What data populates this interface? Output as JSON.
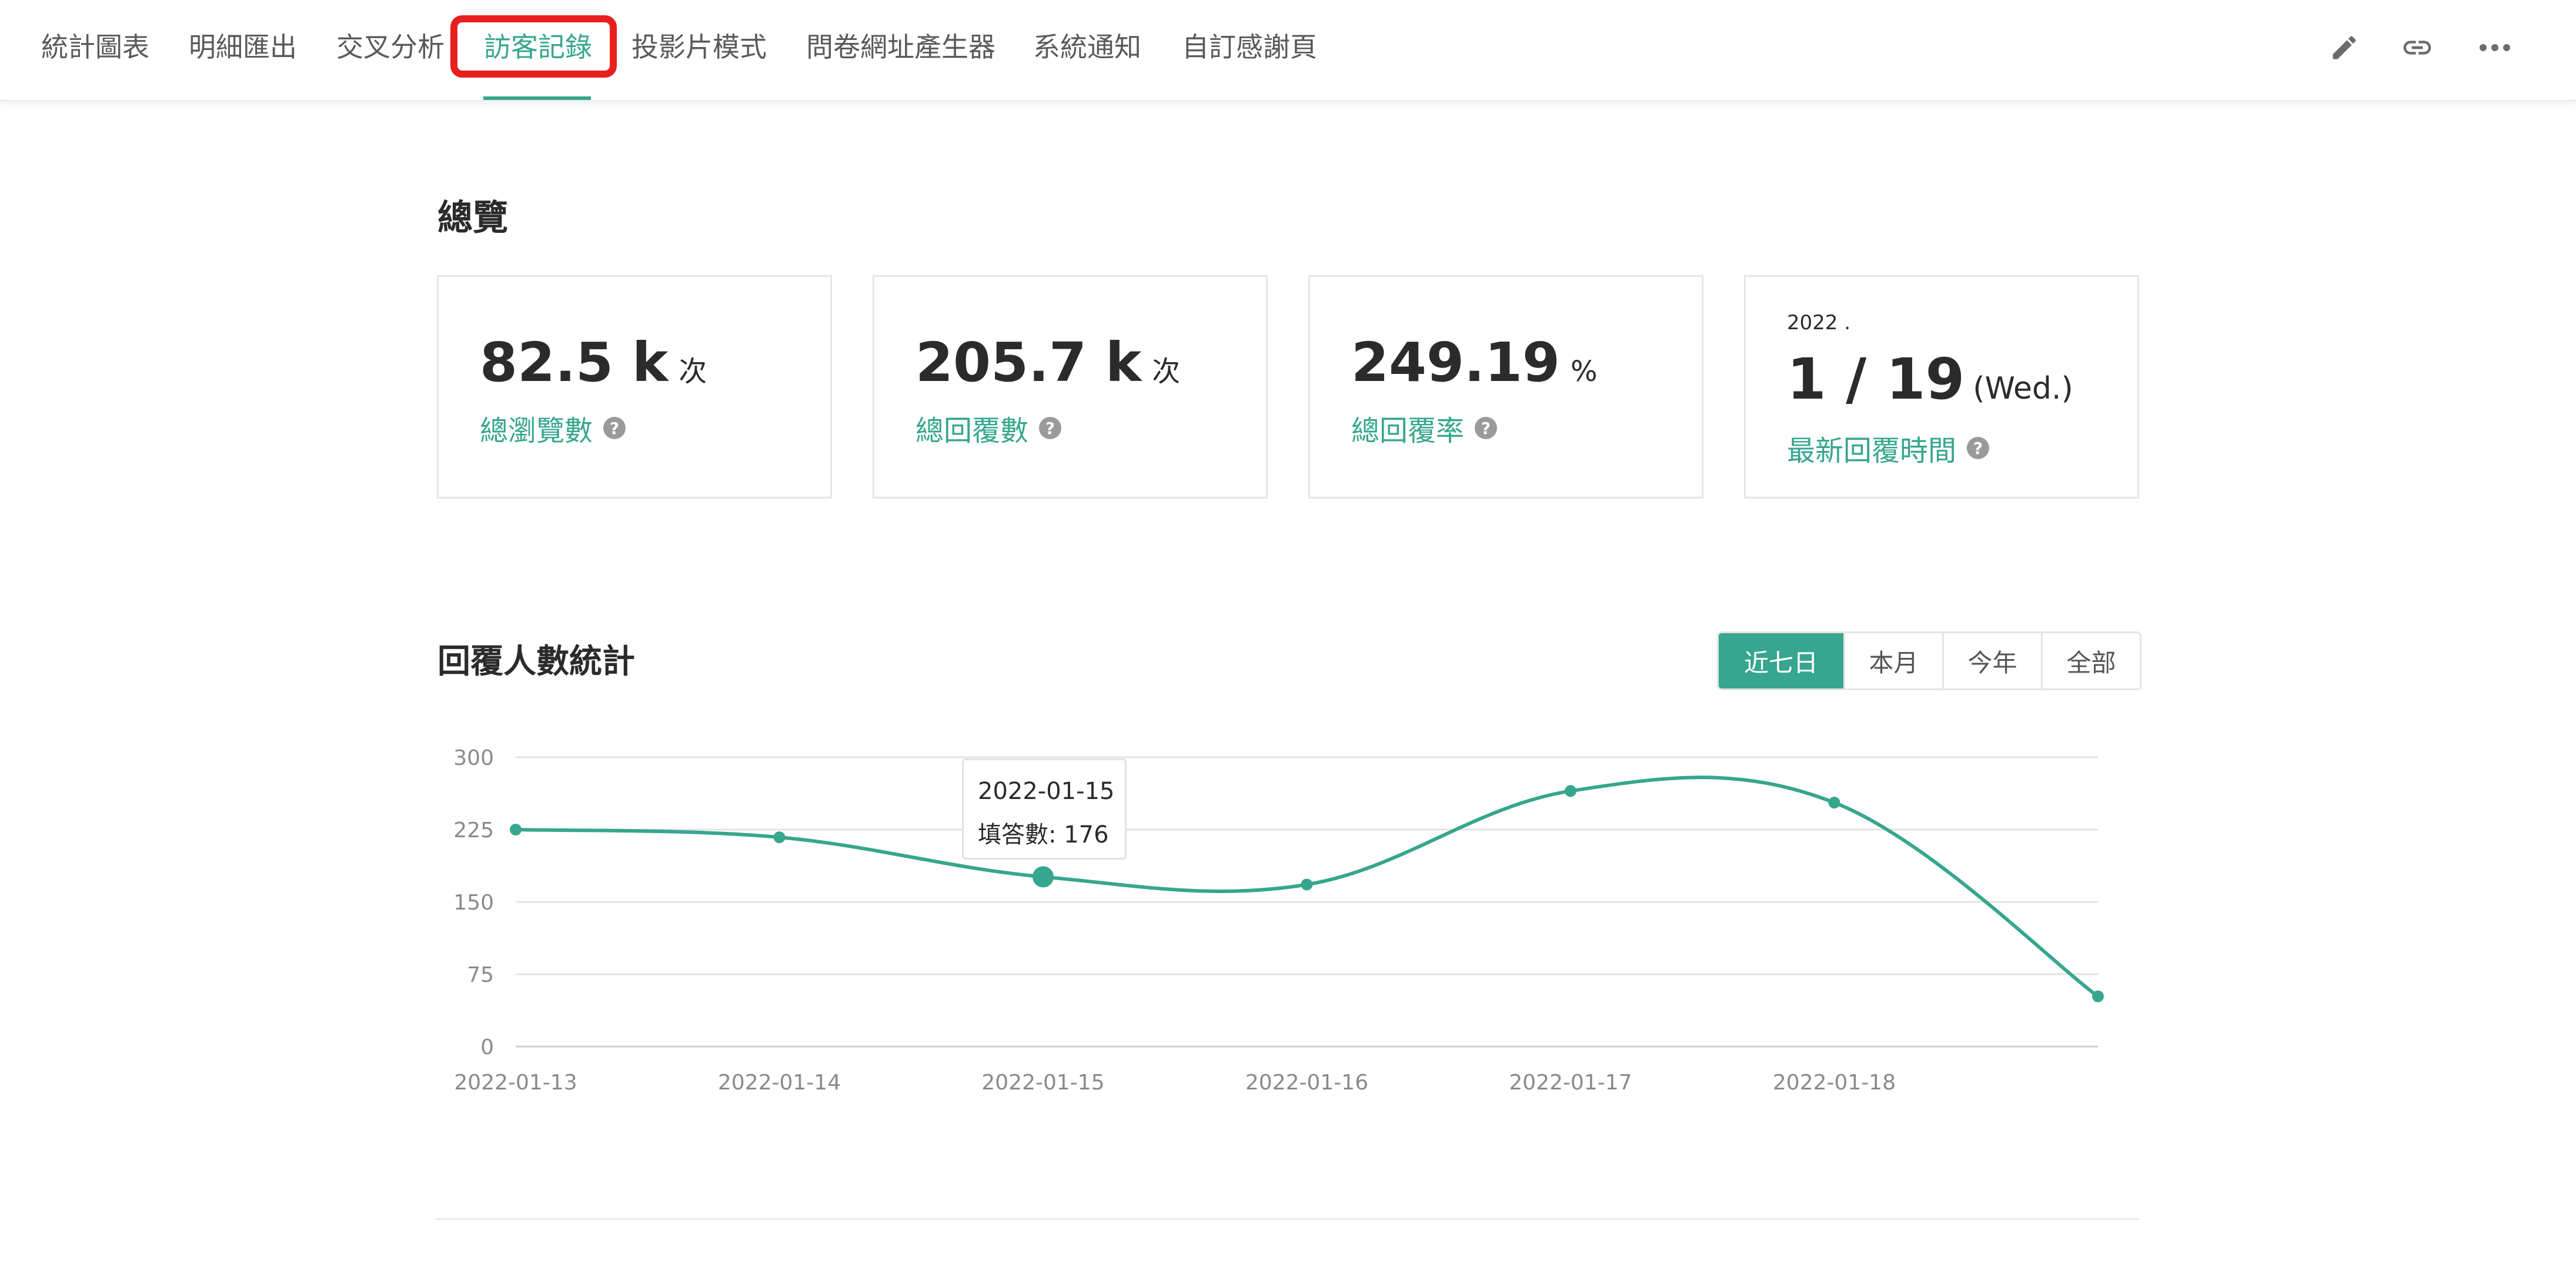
{
  "nav": {
    "tabs": [
      {
        "label": "統計圖表"
      },
      {
        "label": "明細匯出"
      },
      {
        "label": "交叉分析"
      },
      {
        "label": "訪客記錄"
      },
      {
        "label": "投影片模式"
      },
      {
        "label": "問卷網址產生器"
      },
      {
        "label": "系統通知"
      },
      {
        "label": "自訂感謝頁"
      }
    ],
    "active_tab": "訪客記錄",
    "icons": [
      "pencil-icon",
      "link-icon",
      "more-icon"
    ]
  },
  "overview": {
    "title": "總覽",
    "cards": [
      {
        "value": "82.5 k",
        "unit": "次",
        "label": "總瀏覽數"
      },
      {
        "value": "205.7 k",
        "unit": "次",
        "label": "總回覆數"
      },
      {
        "value": "249.19",
        "unit": "%",
        "label": "總回覆率"
      }
    ],
    "latest": {
      "year": "2022 .",
      "date": "1 / 19",
      "weekday": "(Wed.)",
      "label": "最新回覆時間"
    }
  },
  "stats": {
    "title": "回覆人數統計",
    "periods": [
      {
        "label": "近七日"
      },
      {
        "label": "本月"
      },
      {
        "label": "今年"
      },
      {
        "label": "全部"
      }
    ],
    "active_period": "近七日"
  },
  "tooltip": {
    "date": "2022-01-15",
    "text": "填答數: 176"
  },
  "colors": {
    "accent": "#36a68e",
    "highlight": "#e8201d"
  },
  "chart_data": {
    "type": "line",
    "title": "",
    "x": [
      "2022-01-13",
      "2022-01-14",
      "2022-01-15",
      "2022-01-16",
      "2022-01-17",
      "2022-01-18",
      "2022-01-19"
    ],
    "x_tick_labels": [
      "2022-01-13",
      "2022-01-14",
      "2022-01-15",
      "2022-01-16",
      "2022-01-17",
      "2022-01-18"
    ],
    "y_ticks": [
      0,
      75,
      150,
      225,
      300
    ],
    "ylim": [
      0,
      300
    ],
    "grid": true,
    "series": [
      {
        "values": [
          225,
          217,
          176,
          168,
          265,
          253,
          52
        ]
      }
    ],
    "highlighted_point": {
      "x": "2022-01-15",
      "y": 176
    }
  }
}
